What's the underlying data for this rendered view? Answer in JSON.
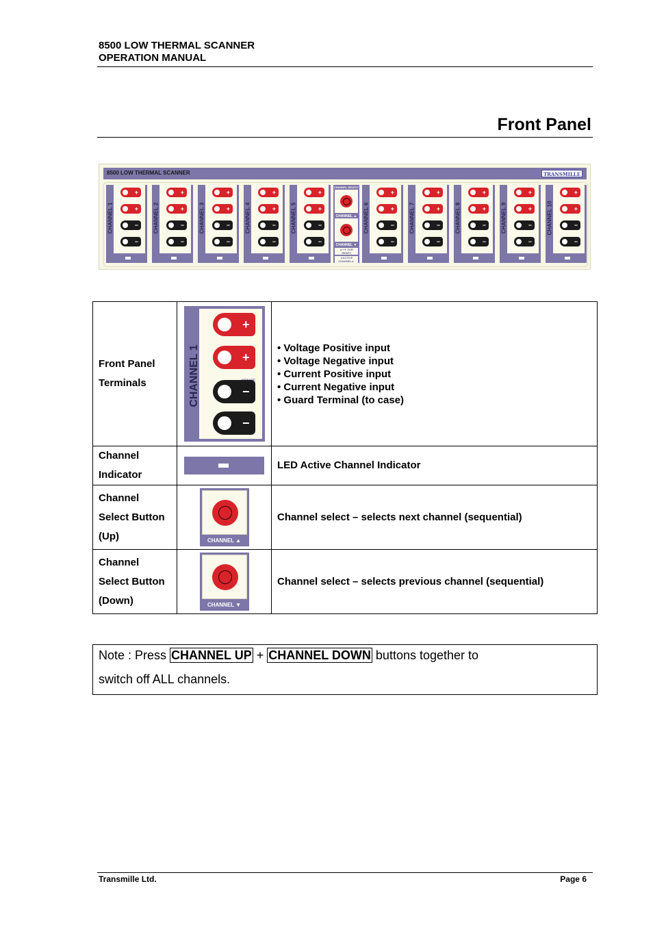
{
  "header": {
    "line1": "8500 LOW THERMAL SCANNER",
    "line2": "OPERATION MANUAL"
  },
  "section_title": "Front Panel",
  "panel": {
    "name": "8500 LOW THERMAL SCANNER",
    "brand": "TRANSMILLE",
    "channels": [
      "CHANNEL 1",
      "CHANNEL 2",
      "CHANNEL 3",
      "CHANNEL 4",
      "CHANNEL 5",
      "CHANNEL 6",
      "CHANNEL 7",
      "CHANNEL 8",
      "CHANNEL 9",
      "CHANNEL 10"
    ],
    "select_title": "CHANNEL SELECT",
    "select_up": "CHANNEL ▲",
    "select_down": "CHANNEL ▼",
    "select_reset": "▲+▼ FOR RESET",
    "active_label": "◄ACTIVE CHANNEL►",
    "terminal_symbols": [
      "+",
      "+",
      "−",
      "−"
    ]
  },
  "table": {
    "rows": [
      {
        "label": "Front Panel Terminals",
        "image_channel": "CHANNEL 1",
        "sense_label": "SENSE",
        "bullets": [
          "• Voltage Positive input",
          "• Voltage Negative input",
          "• Current Positive input",
          "• Current Negative input",
          "• Guard Terminal (to case)"
        ]
      },
      {
        "label": "Channel Indicator",
        "description": "LED Active Channel Indicator"
      },
      {
        "label": "Channel Select Button (Up)",
        "image_label": "CHANNEL ▲",
        "description": "Channel select – selects next channel (sequential)"
      },
      {
        "label": "Channel Select Button (Down)",
        "image_label": "CHANNEL ▼",
        "description": "Channel select – selects previous channel (sequential)"
      }
    ]
  },
  "note": {
    "prefix": "Note : Press ",
    "btn_up": "CHANNEL UP",
    "plus": " + ",
    "btn_down": "CHANNEL DOWN",
    "suffix": " buttons together to",
    "line2": "switch off ALL channels."
  },
  "footer": {
    "company": "Transmille Ltd.",
    "page": "Page 6"
  }
}
